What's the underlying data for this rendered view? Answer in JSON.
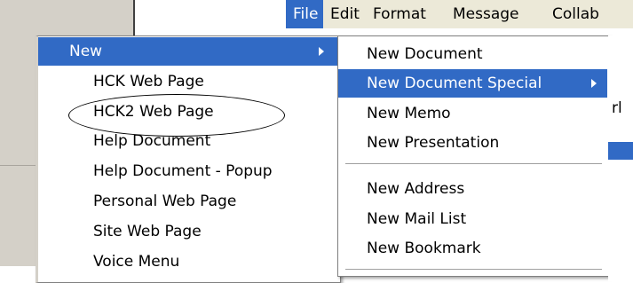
{
  "menubar": {
    "items": [
      "File",
      "Edit",
      "Format",
      "Message",
      "Collab"
    ]
  },
  "primary_menu": {
    "header": "New",
    "items": [
      "HCK Web Page",
      "HCK2  Web Page",
      "Help Document",
      "Help Document - Popup",
      "Personal Web Page",
      "Site Web Page",
      "Voice Menu"
    ]
  },
  "submenu": {
    "items": [
      "New Document",
      "New Document Special",
      "New Memo",
      "New Presentation",
      "New Address",
      "New Mail List",
      "New Bookmark"
    ]
  },
  "partial_text": {
    "fragment1": "rl"
  },
  "colors": {
    "highlight": "#316ac5",
    "menubar_bg": "#ece9d8",
    "workspace_gray": "#d4d0c8"
  }
}
